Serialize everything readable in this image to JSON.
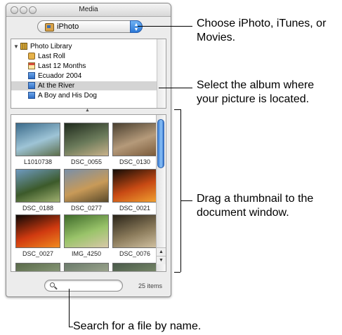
{
  "window": {
    "title": "Media",
    "source_popup": {
      "selected": "iPhoto",
      "icon": "iphoto-icon"
    }
  },
  "source_list": {
    "items": [
      {
        "label": "Photo Library",
        "icon": "photo-library-icon",
        "expanded": true
      },
      {
        "label": "Last Roll",
        "icon": "last-roll-icon"
      },
      {
        "label": "Last 12 Months",
        "icon": "calendar-icon"
      },
      {
        "label": "Ecuador 2004",
        "icon": "album-icon"
      },
      {
        "label": "At the River",
        "icon": "album-icon",
        "selected": true
      },
      {
        "label": "A Boy and His Dog",
        "icon": "album-icon"
      }
    ]
  },
  "thumbnails": [
    {
      "caption": "L1010738",
      "colors": [
        "#3a6a8a",
        "#9ec4d6",
        "#5c6e4a"
      ]
    },
    {
      "caption": "DSC_0055",
      "colors": [
        "#1f2a1c",
        "#6a7a5a",
        "#c9b28a"
      ]
    },
    {
      "caption": "DSC_0130",
      "colors": [
        "#4a4030",
        "#b59a7a",
        "#7a5a3a"
      ]
    },
    {
      "caption": "DSC_0188",
      "colors": [
        "#6e9ac0",
        "#3c5a2a",
        "#a0b070"
      ]
    },
    {
      "caption": "DSC_0277",
      "colors": [
        "#7a8fa8",
        "#c89a58",
        "#5a4a2a"
      ]
    },
    {
      "caption": "DSC_0021",
      "colors": [
        "#140c06",
        "#c84a14",
        "#f0a030"
      ]
    },
    {
      "caption": "DSC_0027",
      "colors": [
        "#0e0806",
        "#d03a10",
        "#f08a20"
      ]
    },
    {
      "caption": "IMG_4250",
      "colors": [
        "#3e6a2a",
        "#9ac46a",
        "#d8c8a8"
      ]
    },
    {
      "caption": "DSC_0076",
      "colors": [
        "#2a2418",
        "#8a7a5a",
        "#d0c0a0"
      ]
    },
    {
      "caption": "",
      "colors": [
        "#5a6a4a",
        "#8a9a7a",
        "#4a4a3a"
      ]
    },
    {
      "caption": "",
      "colors": [
        "#6a7a6a",
        "#a0a890",
        "#4a5040"
      ]
    },
    {
      "caption": "",
      "colors": [
        "#4a5a4a",
        "#7a8a6a",
        "#3a3a2a"
      ]
    }
  ],
  "search": {
    "placeholder": ""
  },
  "item_count": "25 items",
  "callouts": {
    "choose_source": "Choose iPhoto, iTunes, or Movies.",
    "select_album": "Select the album where your picture is located.",
    "drag_thumbnail": "Drag a thumbnail to the document window.",
    "search_file": "Search for a file by name."
  }
}
